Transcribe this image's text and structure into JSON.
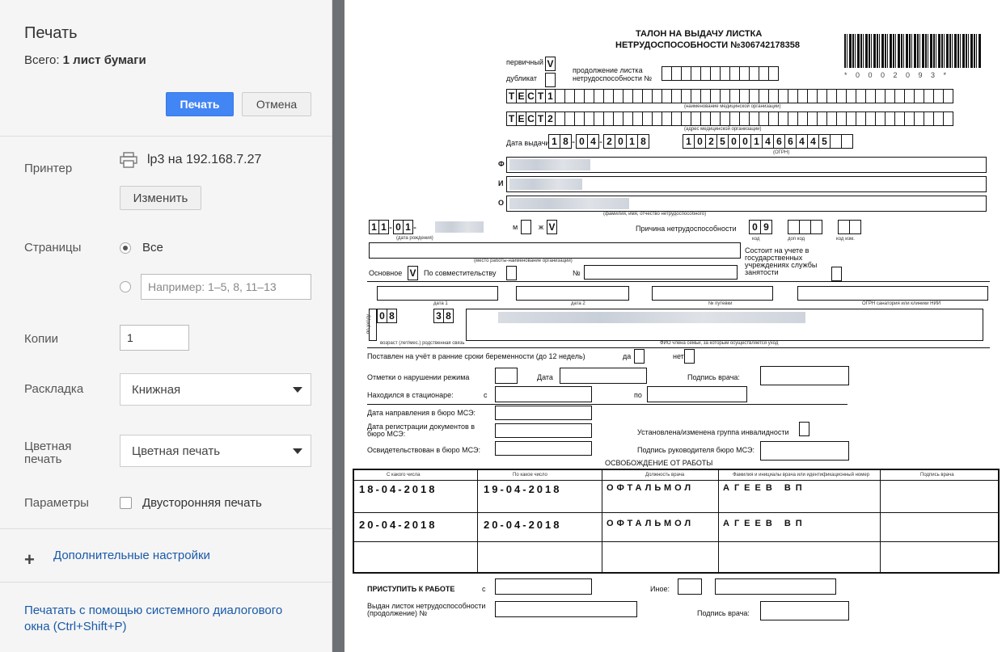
{
  "sidebar": {
    "title": "Печать",
    "total_prefix": "Всего:",
    "total_value": "1 лист бумаги",
    "print_button": "Печать",
    "cancel_button": "Отмена",
    "printer_label": "Принтер",
    "printer_name": "lp3 на 192.168.7.27",
    "change_button": "Изменить",
    "pages_label": "Страницы",
    "pages_all": "Все",
    "pages_placeholder": "Например: 1–5, 8, 11–13",
    "copies_label": "Копии",
    "copies_value": "1",
    "layout_label": "Раскладка",
    "layout_value": "Книжная",
    "color_label": "Цветная печать",
    "color_value": "Цветная печать",
    "params_label": "Параметры",
    "duplex_label": "Двусторонняя печать",
    "more_settings": "Дополнительные настройки",
    "system_dialog": "Печатать с помощью системного диалогового окна (Ctrl+Shift+P)"
  },
  "document": {
    "title_line1": "ТАЛОН НА ВЫДАЧУ ЛИСТКА",
    "title_line2": "НЕТРУДОСПОСОБНОСТИ №306742178358",
    "barcode_text": "* 0 0 0 2 0 9 3 *",
    "primary": "первичный",
    "duplicate": "дубликат",
    "continuation": "продолжение листка нетрудоспособности №",
    "org_name_value": "ТЕСТ1",
    "org_name_caption": "(наименование медицинской организации)",
    "org_addr_value": "ТЕСТ2",
    "org_addr_caption": "(адрес медицинской организации)",
    "issue_date_label": "Дата выдачи",
    "issue_date": "18-04-2018",
    "ogrn": "1025001466445",
    "ogrn_caption": "(ОГРН)",
    "f_label": "Ф",
    "i_label": "И",
    "o_label": "О",
    "fio_caption": "(фамилия, имя, отчество нетрудоспособного)",
    "birth_date_prefix": "11-01-",
    "birth_caption": "(дата рождения)",
    "m_label": "м",
    "zh_label": "ж",
    "reason_label": "Причина нетрудоспособности",
    "reason_code": "09",
    "code_caption": "код",
    "extra_code_caption": "доп код",
    "change_code_caption": "код изм.",
    "work_caption": "(место работы-наименование организации)",
    "employment_registered": "Состоит на учете в государственных учреждениях службы занятости",
    "main_label": "Основное",
    "part_time_label": "По совместительству",
    "number_sign": "№",
    "date1_caption": "дата 1",
    "date2_caption": "дата 2",
    "voucher_caption": "№ путевки",
    "sanatorium_caption": "ОГРН санатория или клиники НИИ",
    "care_label": "по уходу",
    "care_age": "08",
    "care_relation": "38",
    "care_captions": "возраст (лет/мес.)   родственная связь",
    "care_fio_caption": "ФИО члена семьи, за которым осуществляется уход",
    "pregnancy": "Поставлен на учёт в ранние сроки беременности (до 12 недель)",
    "yes": "да",
    "no": "нет",
    "violation": "Отметки о нарушении режима",
    "date_label": "Дата",
    "doctor_sign": "Подпись врача:",
    "hospital": "Находился в стационаре:",
    "from": "с",
    "to": "по",
    "mse_direction": "Дата направления в бюро МСЭ:",
    "mse_registration": "Дата регистрации документов в бюро МСЭ:",
    "disability_group": "Установлена/изменена группа инвалидности",
    "mse_exam": "Освидетельствован в бюро МСЭ:",
    "mse_head_sign": "Подпись руководителя бюро МСЭ:",
    "release_title": "ОСВОБОЖДЕНИЕ ОТ РАБОТЫ",
    "table_headers": [
      "С какого числа",
      "По какое число",
      "Должность врача",
      "Фамилия и инициалы врача или идентификационный номер",
      "Подпись врача"
    ],
    "rows": [
      {
        "from": "18-04-2018",
        "to": "19-04-2018",
        "position": "ОФТАЛЬМОЛ",
        "doctor": "АГЕЕВ ВП"
      },
      {
        "from": "20-04-2018",
        "to": "20-04-2018",
        "position": "ОФТАЛЬМОЛ",
        "doctor": "АГЕЕВ ВП"
      }
    ],
    "return_to_work": "ПРИСТУПИТЬ К РАБОТЕ",
    "other": "Иное:",
    "issued_continuation": "Выдан листок нетрудоспособности (продолжение) №"
  }
}
